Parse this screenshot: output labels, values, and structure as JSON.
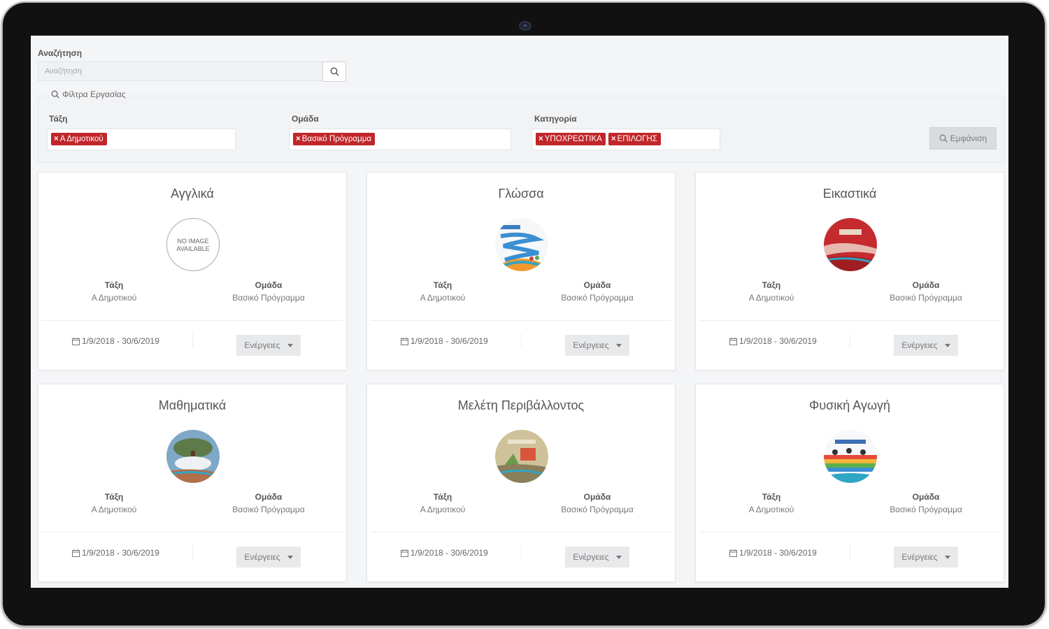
{
  "search": {
    "label": "Αναζήτηση",
    "placeholder": "Αναζήτηση",
    "value": ""
  },
  "filters": {
    "title": "Φίλτρα Εργασίας",
    "class_label": "Τάξη",
    "class_tags": [
      "Α Δημοτικού"
    ],
    "group_label": "Ομάδα",
    "group_tags": [
      "Βασικό Πρόγραμμα"
    ],
    "category_label": "Κατηγορία",
    "category_tags": [
      "ΥΠΟΧΡΕΩΤΙΚΑ",
      "ΕΠΙΛΟΓΗΣ"
    ],
    "show_button": "Εμφάνιση"
  },
  "card_labels": {
    "class": "Τάξη",
    "group": "Ομάδα",
    "actions": "Ενέργειες"
  },
  "cards": [
    {
      "title": "Αγγλικά",
      "class": "Α Δημοτικού",
      "group": "Βασικό Πρόγραμμα",
      "dates": "1/9/2018 - 30/6/2019",
      "image_text": "NO IMAGE AVAILABLE"
    },
    {
      "title": "Γλώσσα",
      "class": "Α Δημοτικού",
      "group": "Βασικό Πρόγραμμα",
      "dates": "1/9/2018 - 30/6/2019"
    },
    {
      "title": "Εικαστικά",
      "class": "Α Δημοτικού",
      "group": "Βασικό Πρόγραμμα",
      "dates": "1/9/2018 - 30/6/2019"
    },
    {
      "title": "Μαθηματικά",
      "class": "Α Δημοτικού",
      "group": "Βασικό Πρόγραμμα",
      "dates": "1/9/2018 - 30/6/2019"
    },
    {
      "title": "Μελέτη Περιβάλλοντος",
      "class": "Α Δημοτικού",
      "group": "Βασικό Πρόγραμμα",
      "dates": "1/9/2018 - 30/6/2019"
    },
    {
      "title": "Φυσική Αγωγή",
      "class": "Α Δημοτικού",
      "group": "Βασικό Πρόγραμμα",
      "dates": "1/9/2018 - 30/6/2019"
    }
  ],
  "colors": {
    "tag": "#c0262a",
    "background": "#f4f5f7"
  }
}
